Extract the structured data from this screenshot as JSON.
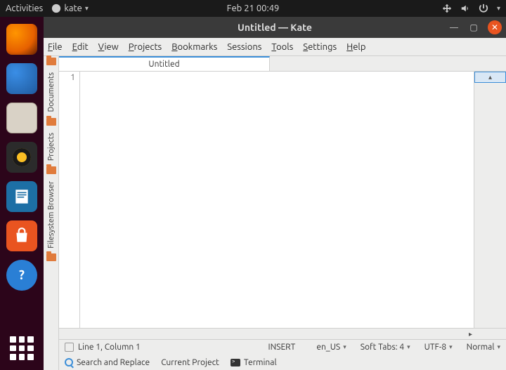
{
  "topbar": {
    "activities": "Activities",
    "appname": "kate",
    "datetime": "Feb 21  00:49"
  },
  "window": {
    "title": "Untitled  — Kate"
  },
  "menus": {
    "file": "File",
    "edit": "Edit",
    "view": "View",
    "projects": "Projects",
    "bookmarks": "Bookmarks",
    "sessions": "Sessions",
    "tools": "Tools",
    "settings": "Settings",
    "help": "Help"
  },
  "sidepanel": {
    "documents": "Documents",
    "projects": "Projects",
    "fsbrowser": "Filesystem Browser"
  },
  "tab": {
    "title": "Untitled"
  },
  "gutter": {
    "line1": "1"
  },
  "status": {
    "position": "Line 1, Column 1",
    "mode": "INSERT",
    "locale": "en_US",
    "indent": "Soft Tabs: 4",
    "encoding": "UTF-8",
    "editmode": "Normal"
  },
  "bottom": {
    "search": "Search and Replace",
    "project": "Current Project",
    "terminal": "Terminal"
  }
}
